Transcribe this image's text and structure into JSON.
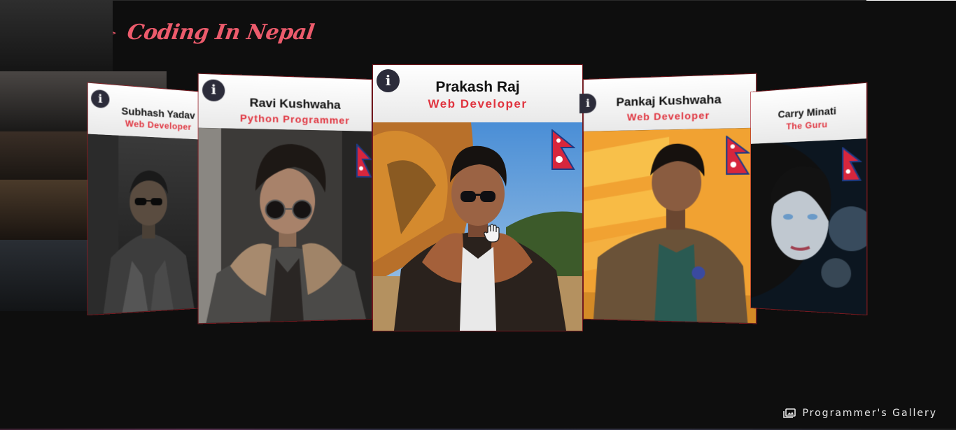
{
  "header": {
    "icon": "exit-icon",
    "code_symbol": "< / >",
    "brand": "Coding In Nepal"
  },
  "colors": {
    "background": "#0e0e0e",
    "accent": "#e0343f",
    "brand": "#ec5b6c"
  },
  "cards": [
    {
      "name": "Subhash Yadav",
      "role": "Web Developer",
      "icon": "info-icon",
      "flag": "nepal-flag"
    },
    {
      "name": "Ravi Kushwaha",
      "role": "Python Programmer",
      "icon": "info-icon",
      "flag": "nepal-flag"
    },
    {
      "name": "Prakash Raj",
      "role": "Web Developer",
      "icon": "info-icon",
      "flag": "nepal-flag"
    },
    {
      "name": "Pankaj Kushwaha",
      "role": "Web Developer",
      "icon": "info-icon",
      "flag": "nepal-flag"
    },
    {
      "name": "Carry Minati",
      "role": "The Guru",
      "icon": "info-icon",
      "flag": "nepal-flag"
    }
  ],
  "footer": {
    "icon": "gallery-icon",
    "label": "Programmer's Gallery"
  }
}
